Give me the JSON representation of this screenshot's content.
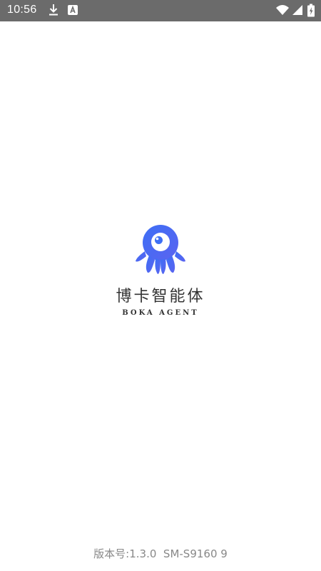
{
  "status_bar": {
    "time": "10:56",
    "icons": [
      "download-icon",
      "app-a-icon",
      "wifi-icon",
      "signal-icon",
      "battery-icon"
    ],
    "background": "#6b6b6b"
  },
  "splash": {
    "logo_icon": "octopus-logo-icon",
    "logo_color": "#4a6cf7",
    "app_name": "博卡智能体",
    "app_subtitle": "BOKA AGENT"
  },
  "footer": {
    "version_text": "版本号:1.3.0  SM-S9160 9"
  }
}
